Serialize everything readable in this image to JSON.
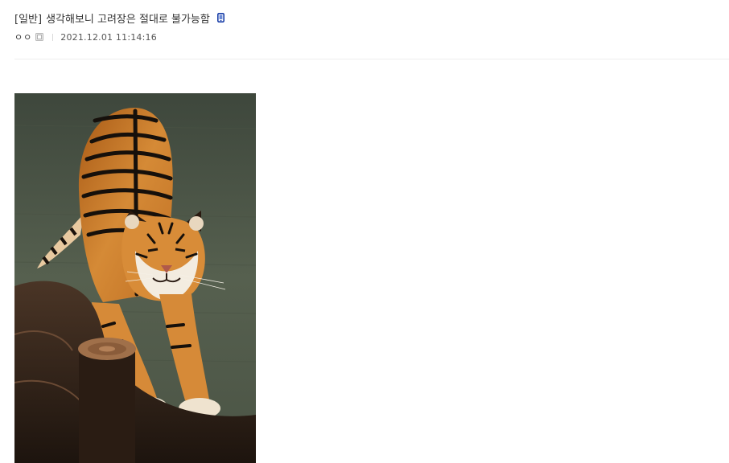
{
  "post": {
    "head": "[일반]",
    "title": "생각해보니 고려장은 절대로 불가능함",
    "writer_nick": "ㅇㅇ",
    "date": "2021.12.01 11:14:16",
    "mobile_icon": "mobile-phone-icon",
    "gallog_icon": "gallog-icon"
  },
  "colors": {
    "mobile_icon": "#1a3fa8",
    "divider": "#eeeeee"
  }
}
